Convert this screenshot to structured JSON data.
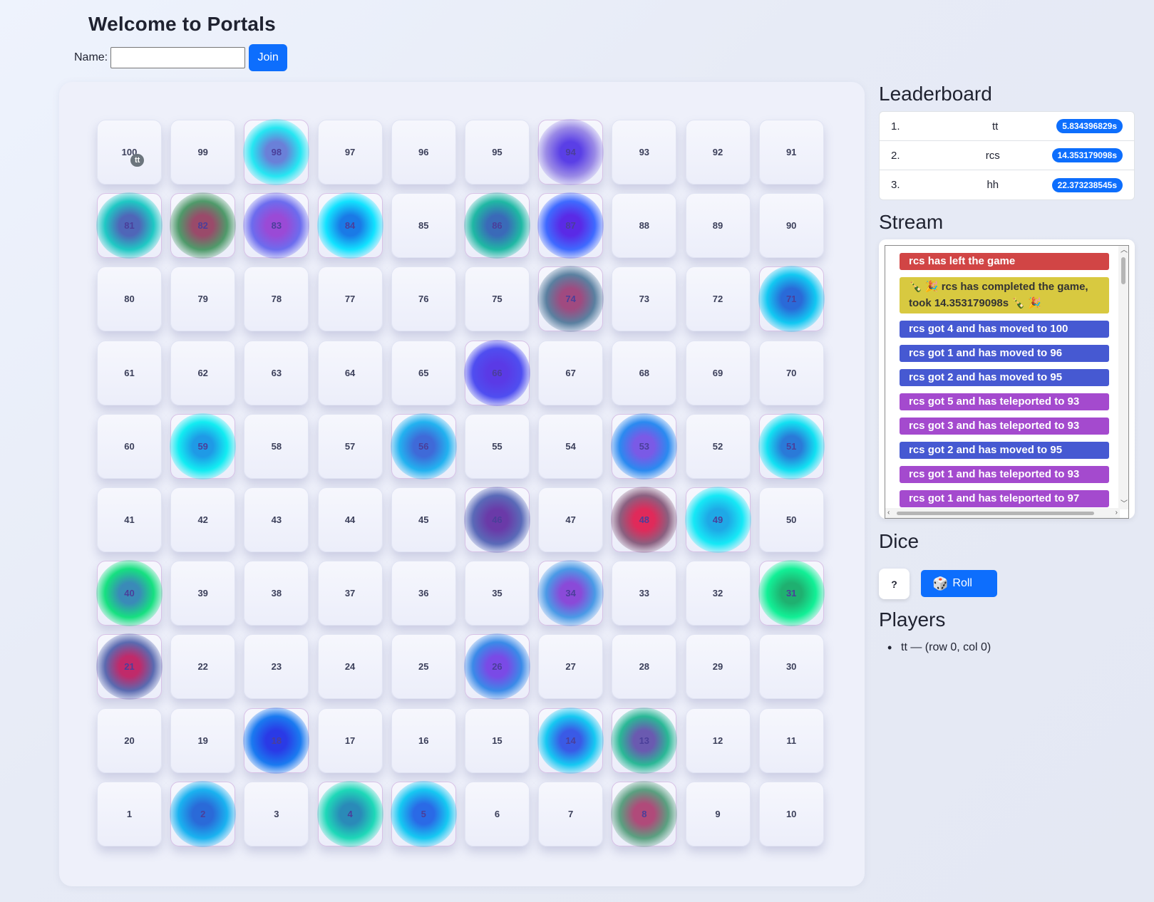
{
  "header": {
    "title": "Welcome to Portals",
    "name_label": "Name:",
    "name_value": "",
    "join_label": "Join"
  },
  "board": {
    "rows": [
      [
        100,
        99,
        98,
        97,
        96,
        95,
        94,
        93,
        92,
        91
      ],
      [
        81,
        82,
        83,
        84,
        85,
        86,
        87,
        88,
        89,
        90
      ],
      [
        80,
        79,
        78,
        77,
        76,
        75,
        74,
        73,
        72,
        71
      ],
      [
        61,
        62,
        63,
        64,
        65,
        66,
        67,
        68,
        69,
        70
      ],
      [
        60,
        59,
        58,
        57,
        56,
        55,
        54,
        53,
        52,
        51
      ],
      [
        41,
        42,
        43,
        44,
        45,
        46,
        47,
        48,
        49,
        50
      ],
      [
        40,
        39,
        38,
        37,
        36,
        35,
        34,
        33,
        32,
        31
      ],
      [
        21,
        22,
        23,
        24,
        25,
        26,
        27,
        28,
        29,
        30
      ],
      [
        20,
        19,
        18,
        17,
        16,
        15,
        14,
        13,
        12,
        11
      ],
      [
        1,
        2,
        3,
        4,
        5,
        6,
        7,
        8,
        9,
        10
      ]
    ],
    "portals": {
      "98": [
        "#6a80d8",
        "#26e6f2"
      ],
      "94": [
        "#5a3fe6",
        "#9a8ae6"
      ],
      "81": [
        "#4f66b8",
        "#1fc8c4"
      ],
      "82": [
        "#9a4a6a",
        "#4f9a6a"
      ],
      "83": [
        "#9a4ad6",
        "#6c6cee"
      ],
      "84": [
        "#1a7ae6",
        "#12e2ff"
      ],
      "86": [
        "#3a6ab8",
        "#1fb8a4"
      ],
      "87": [
        "#5a2ae6",
        "#3f6aff"
      ],
      "74": [
        "#a04a80",
        "#5a80a0"
      ],
      "71": [
        "#2a6ad8",
        "#12c8f2"
      ],
      "66": [
        "#5a3ae6",
        "#4f4ef0"
      ],
      "59": [
        "#1f9ae6",
        "#12ecf2"
      ],
      "56": [
        "#3f6ad8",
        "#22b2f0"
      ],
      "53": [
        "#7a5ae6",
        "#2a8af0"
      ],
      "51": [
        "#2a7ad8",
        "#12e0f2"
      ],
      "46": [
        "#6a3aa8",
        "#5a6ab8"
      ],
      "48": [
        "#e02a5a",
        "#8a6080"
      ],
      "49": [
        "#1fa8e6",
        "#16e8f6"
      ],
      "40": [
        "#3a8ab8",
        "#16e080"
      ],
      "34": [
        "#8a4ad8",
        "#4a9ae6"
      ],
      "31": [
        "#1fb070",
        "#12f096"
      ],
      "21": [
        "#c02a6a",
        "#5a6ab0"
      ],
      "26": [
        "#7a4ae6",
        "#3a8ae8"
      ],
      "18": [
        "#2a3ae6",
        "#1a7af0"
      ],
      "14": [
        "#3a5ae6",
        "#16c8f2"
      ],
      "13": [
        "#6a5ab0",
        "#2ab896"
      ],
      "2": [
        "#2a6ad8",
        "#1ab2f0"
      ],
      "4": [
        "#2a8ab8",
        "#1ed8b8"
      ],
      "5": [
        "#2a6ae6",
        "#16c8f2"
      ],
      "8": [
        "#b04a7a",
        "#5aa080"
      ]
    },
    "tokens": {
      "100": "tt"
    }
  },
  "leaderboard": {
    "title": "Leaderboard",
    "rows": [
      {
        "rank": "1.",
        "name": "tt",
        "time": "5.834396829s"
      },
      {
        "rank": "2.",
        "name": "rcs",
        "time": "14.353179098s"
      },
      {
        "rank": "3.",
        "name": "hh",
        "time": "22.373238545s"
      }
    ]
  },
  "stream": {
    "title": "Stream",
    "messages": [
      {
        "kind": "left",
        "text": "rcs has left the game"
      },
      {
        "kind": "done",
        "text": "🍾 🎉 rcs has completed the game, took 14.353179098s 🍾 🎉"
      },
      {
        "kind": "move",
        "text": "rcs got 4 and has moved to 100"
      },
      {
        "kind": "move",
        "text": "rcs got 1 and has moved to 96"
      },
      {
        "kind": "move",
        "text": "rcs got 2 and has moved to 95"
      },
      {
        "kind": "tele",
        "text": "rcs got 5 and has teleported to 93"
      },
      {
        "kind": "tele",
        "text": "rcs got 3 and has teleported to 93"
      },
      {
        "kind": "move",
        "text": "rcs got 2 and has moved to 95"
      },
      {
        "kind": "tele",
        "text": "rcs got 1 and has teleported to 93"
      },
      {
        "kind": "tele",
        "text": "rcs got 1 and has teleported to 97"
      }
    ]
  },
  "dice": {
    "title": "Dice",
    "face": "?",
    "roll_icon": "🎲",
    "roll_label": "Roll"
  },
  "players": {
    "title": "Players",
    "items": [
      "tt — (row 0, col 0)"
    ]
  }
}
